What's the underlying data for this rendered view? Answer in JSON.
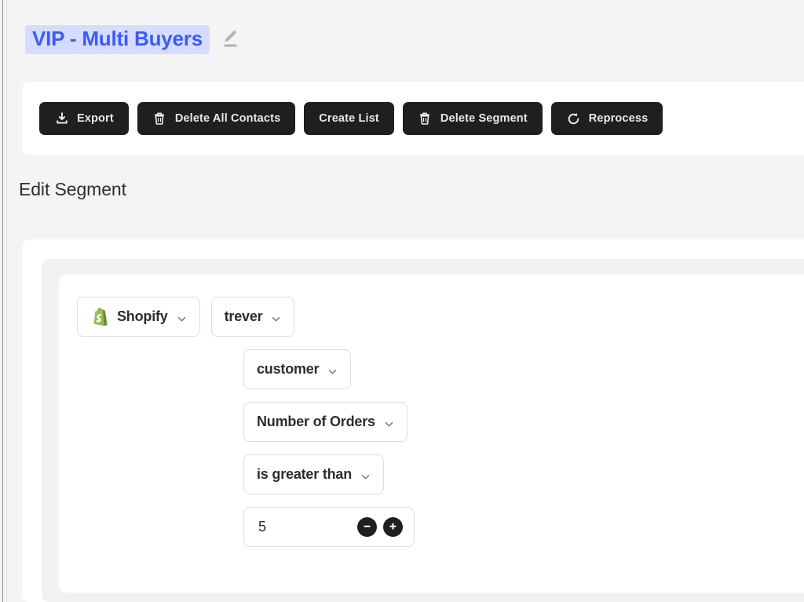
{
  "header": {
    "segment_title": "VIP - Multi Buyers",
    "edit_icon": "pencil-icon",
    "title_bg": "#d6dcfd",
    "title_color": "#3b5bf5"
  },
  "toolbar": {
    "buttons": [
      {
        "label": "Export",
        "icon": "download-icon"
      },
      {
        "label": "Delete All Contacts",
        "icon": "trash-icon"
      },
      {
        "label": "Create List",
        "icon": "none"
      },
      {
        "label": "Delete Segment",
        "icon": "trash-icon"
      },
      {
        "label": "Reprocess",
        "icon": "refresh-icon"
      }
    ],
    "button_bg": "#1f1f21",
    "button_color": "#e9e9ea"
  },
  "section": {
    "heading": "Edit Segment"
  },
  "rule": {
    "source": {
      "label": "Shopify",
      "icon": "shopify-icon"
    },
    "account": {
      "label": "trever"
    },
    "object": {
      "label": "customer"
    },
    "field": {
      "label": "Number of Orders"
    },
    "operator": {
      "label": "is greater than"
    },
    "value": {
      "current": "5",
      "placeholder": "",
      "decrement": "minus-icon",
      "increment": "plus-icon"
    }
  }
}
